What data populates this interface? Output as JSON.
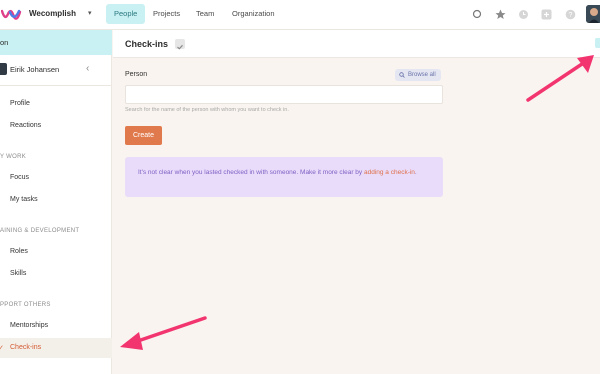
{
  "topbar": {
    "org_name": "Wecomplish",
    "tabs": [
      {
        "label": "People",
        "active": true
      },
      {
        "label": "Projects",
        "active": false
      },
      {
        "label": "Team",
        "active": false
      },
      {
        "label": "Organization",
        "active": false
      }
    ],
    "icons": [
      "search-icon",
      "star-icon",
      "clock-icon",
      "plus-icon",
      "help-icon"
    ],
    "accent_color": "#c9f0f2"
  },
  "sidebar": {
    "banner_label": "on",
    "user_name": "Eirik Johansen",
    "sections": [
      {
        "title": "",
        "items": [
          {
            "label": "Profile"
          },
          {
            "label": "Reactions"
          }
        ]
      },
      {
        "title": "Y WORK",
        "items": [
          {
            "label": "Focus"
          },
          {
            "label": "My tasks"
          }
        ]
      },
      {
        "title": "AINING & DEVELOPMENT",
        "items": [
          {
            "label": "Roles"
          },
          {
            "label": "Skills"
          }
        ]
      },
      {
        "title": "PPORT OTHERS",
        "items": [
          {
            "label": "Mentorships"
          },
          {
            "label": "Check-ins",
            "active": true
          }
        ]
      }
    ]
  },
  "main": {
    "title": "Check-ins",
    "person_label": "Person",
    "browse_all": "Browse all",
    "person_input_value": "",
    "helper_text": "Search for the name of the person with whom you want to check in.",
    "create_label": "Create",
    "notice_text": "It's not clear when you lasted checked in with someone. Make it more clear by ",
    "notice_link": "adding a check-in",
    "notice_end": "."
  },
  "colors": {
    "primary_button": "#e07a4d",
    "notice_bg": "#e8dcfa",
    "notice_text": "#8160c4",
    "arrow": "#f2356f"
  }
}
